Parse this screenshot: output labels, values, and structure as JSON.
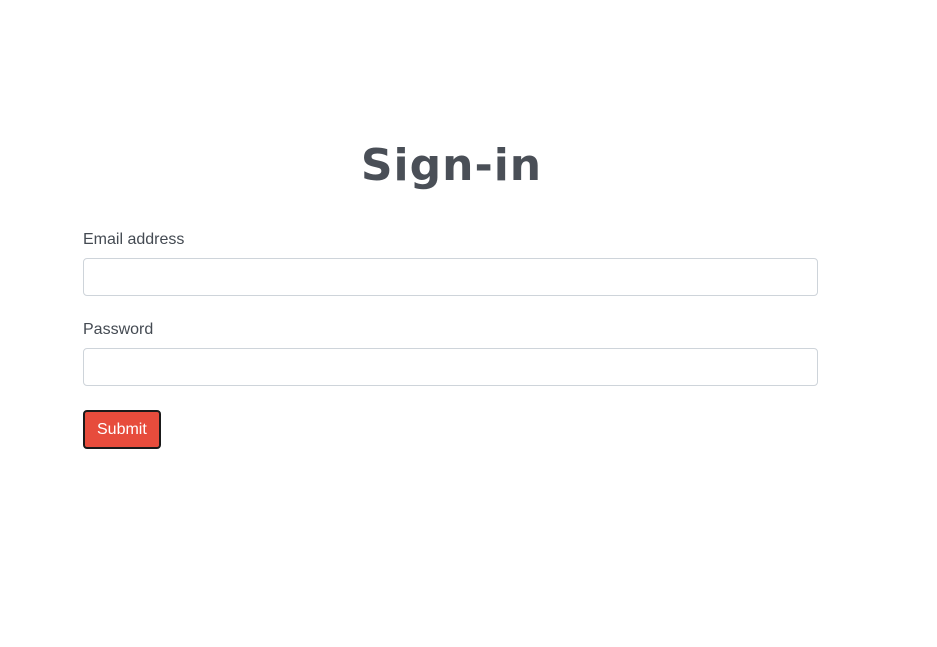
{
  "page": {
    "title": "Sign-in"
  },
  "form": {
    "email": {
      "label": "Email address",
      "value": "",
      "placeholder": ""
    },
    "password": {
      "label": "Password",
      "value": "",
      "placeholder": ""
    },
    "submit_label": "Submit"
  },
  "colors": {
    "title_text": "#4a4f57",
    "submit_background": "#e74c3c",
    "submit_border": "#1a1a1a",
    "input_border": "#ced4da"
  }
}
